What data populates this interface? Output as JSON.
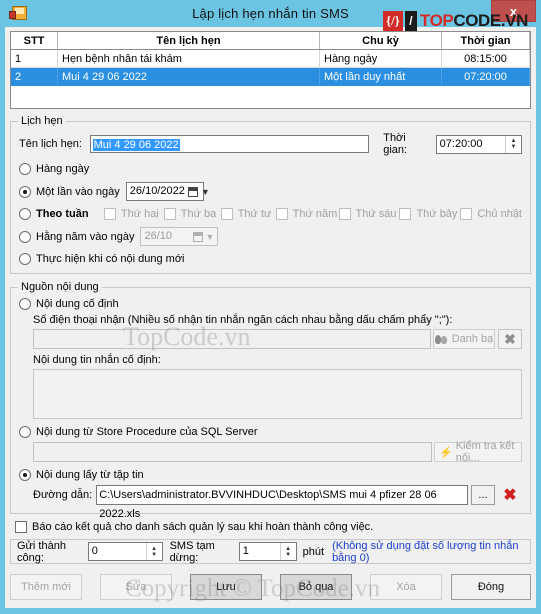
{
  "window": {
    "title": "Lập lịch hẹn nhắn tin SMS",
    "app_icon": "schedule-app-icon",
    "close_label": "x",
    "accent_color": "#6cc4e3"
  },
  "logo": {
    "bracket": "{/}",
    "slash": "/",
    "text_red": "TOP",
    "text_dark": "CODE.VN",
    "red": "#d32b28"
  },
  "watermarks": {
    "w1": "TopCode.vn",
    "w2": "Copyright © TopCode.vn"
  },
  "grid": {
    "columns": [
      "STT",
      "Tên lịch hẹn",
      "Chu kỳ",
      "Thời gian"
    ],
    "rows": [
      {
        "stt": "1",
        "name": "Hẹn bệnh nhân tái khám",
        "cycle": "Hàng ngày",
        "time": "08:15:00",
        "selected": false
      },
      {
        "stt": "2",
        "name": "Mui 4 29 06 2022",
        "cycle": "Một lần duy nhất",
        "time": "07:20:00",
        "selected": true
      }
    ],
    "selection_color": "#2a8fe0"
  },
  "schedule": {
    "legend": "Lịch hẹn",
    "name_label": "Tên lịch hẹn:",
    "name_value": "Mui 4 29 06 2022",
    "time_label": "Thời gian:",
    "time_value": "07:20:00",
    "opt_daily": "Hàng ngày",
    "opt_once": "Một lần vào ngày",
    "once_date": "26/10/2022",
    "opt_weekly": "Theo tuần",
    "weekdays": [
      "Thứ hai",
      "Thứ ba",
      "Thứ tư",
      "Thứ năm",
      "Thứ sáu",
      "Thứ bảy",
      "Chủ nhật"
    ],
    "opt_yearly": "Hằng năm vào ngày",
    "yearly_date": "26/10",
    "opt_on_new": "Thực hiện khi có nội dung mới"
  },
  "source": {
    "legend": "Nguồn nội dung",
    "opt_fixed": "Nội dung cố định",
    "phone_label": "Số điện thoại nhận (Nhiều số nhận tin nhắn ngăn cách nhau bằng dấu chấm phẩy \";\"):",
    "phone_value": "",
    "contacts_button": "Danh bạ",
    "clear_button": "✖",
    "message_label": "Nội dung tin nhắn cố định:",
    "message_value": "",
    "opt_sql": "Nội dung từ Store Procedure của SQL Server",
    "sql_value": "",
    "test_conn_button": "Kiểm tra kết nối...",
    "opt_file": "Nội dung lấy từ tập tin",
    "path_label": "Đường dẫn:",
    "path_value": "C:\\Users\\administrator.BVVINHDUC\\Desktop\\SMS mui 4 pfizer 28 06 2022.xls",
    "browse_button": "...",
    "remove_button": "✖"
  },
  "report_checkbox": "Báo cáo kết quả cho danh sách quản lý sau khi hoàn thành công việc.",
  "status": {
    "sent_label": "Gửi thành công:",
    "sent_value": "0",
    "pause_label": "SMS tạm dừng:",
    "pause_value": "1",
    "unit": "phút",
    "note": "(Không sử dụng đặt số lượng tin nhắn bằng 0)",
    "note_color": "#1b3fd0"
  },
  "buttons": {
    "add": "Thêm mới",
    "edit": "Sửa",
    "save": "Lưu",
    "cancel": "Bỏ qua",
    "delete": "Xóa",
    "close": "Đóng"
  }
}
